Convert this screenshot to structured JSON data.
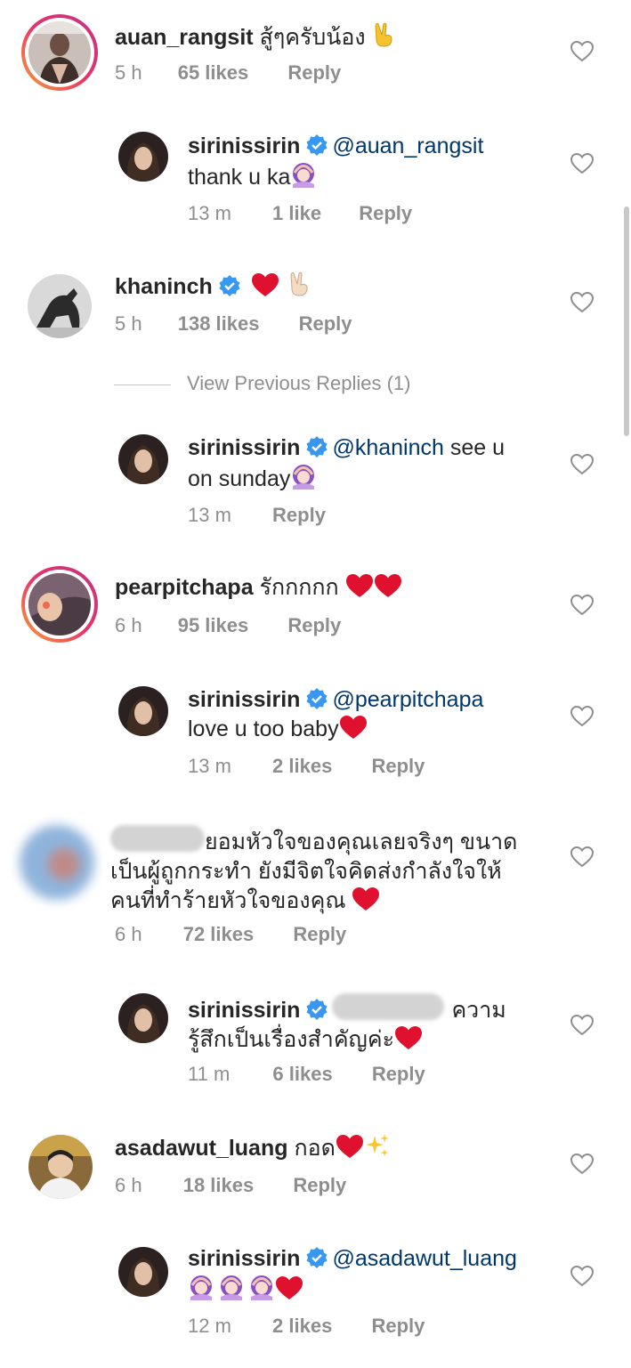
{
  "comments": [
    {
      "username": "auan_rangsit",
      "text": "สู้ๆครับน้อง",
      "time": "5 h",
      "likes": "65 likes",
      "reply": "Reply",
      "story_ring": true,
      "emoji": [
        "victory-hand"
      ]
    },
    {
      "username": "sirinissirin",
      "verified": true,
      "mention": "@auan_rangsit",
      "text": "thank u ka",
      "time": "13 m",
      "likes": "1 like",
      "reply": "Reply",
      "emoji": [
        "person-gesturing-ok"
      ]
    },
    {
      "username": "khaninch",
      "verified": true,
      "text": "",
      "time": "5 h",
      "likes": "138 likes",
      "reply": "Reply",
      "emoji": [
        "red-heart",
        "victory-hand"
      ]
    },
    {
      "username": "sirinissirin",
      "verified": true,
      "mention": "@khaninch",
      "text_line1": " see u",
      "text_line2": "on sunday",
      "time": "13 m",
      "likes": "",
      "reply": "Reply",
      "emoji": [
        "person-gesturing-ok"
      ]
    },
    {
      "username": "pearpitchapa",
      "text": "รักกกกก",
      "time": "6 h",
      "likes": "95 likes",
      "reply": "Reply",
      "story_ring": true,
      "emoji": [
        "red-heart",
        "red-heart"
      ]
    },
    {
      "username": "sirinissirin",
      "verified": true,
      "mention": "@pearpitchapa",
      "text": "love u too baby",
      "time": "13 m",
      "likes": "2 likes",
      "reply": "Reply",
      "emoji": [
        "red-heart"
      ]
    },
    {
      "username": "",
      "text_line1": "ยอมหัวใจของคุณเลยจริงๆ ขนาด",
      "text_line2": "เป็นผู้ถูกกระทำ ยังมีจิตใจคิดส่งกำลังใจให้",
      "text_line3": "คนที่ทำร้ายหัวใจของคุณ",
      "time": "6 h",
      "likes": "72 likes",
      "reply": "Reply",
      "emoji": [
        "red-heart"
      ]
    },
    {
      "username": "sirinissirin",
      "verified": true,
      "text_line1": "ความ",
      "text_line2": "รู้สึกเป็นเรื่องสำคัญค่ะ",
      "time": "11 m",
      "likes": "6 likes",
      "reply": "Reply",
      "emoji": [
        "red-heart"
      ]
    },
    {
      "username": "asadawut_luang",
      "text": "กอด",
      "time": "6 h",
      "likes": "18 likes",
      "reply": "Reply",
      "emoji": [
        "red-heart",
        "sparkles"
      ]
    },
    {
      "username": "sirinissirin",
      "verified": true,
      "mention": "@asadawut_luang",
      "text": "",
      "time": "12 m",
      "likes": "2 likes",
      "reply": "Reply",
      "emoji": [
        "person-gesturing-ok",
        "person-gesturing-ok",
        "person-gesturing-ok",
        "red-heart"
      ]
    }
  ],
  "view_previous_replies": "View Previous Replies (1)",
  "icons": {
    "like": "heart-outline-icon",
    "verified": "verified-badge-icon"
  },
  "colors": {
    "text": "#262626",
    "secondary": "#8e8e8e",
    "mention": "#00376b",
    "verified": "#3897f0",
    "heart_emoji": "#e0102f"
  }
}
